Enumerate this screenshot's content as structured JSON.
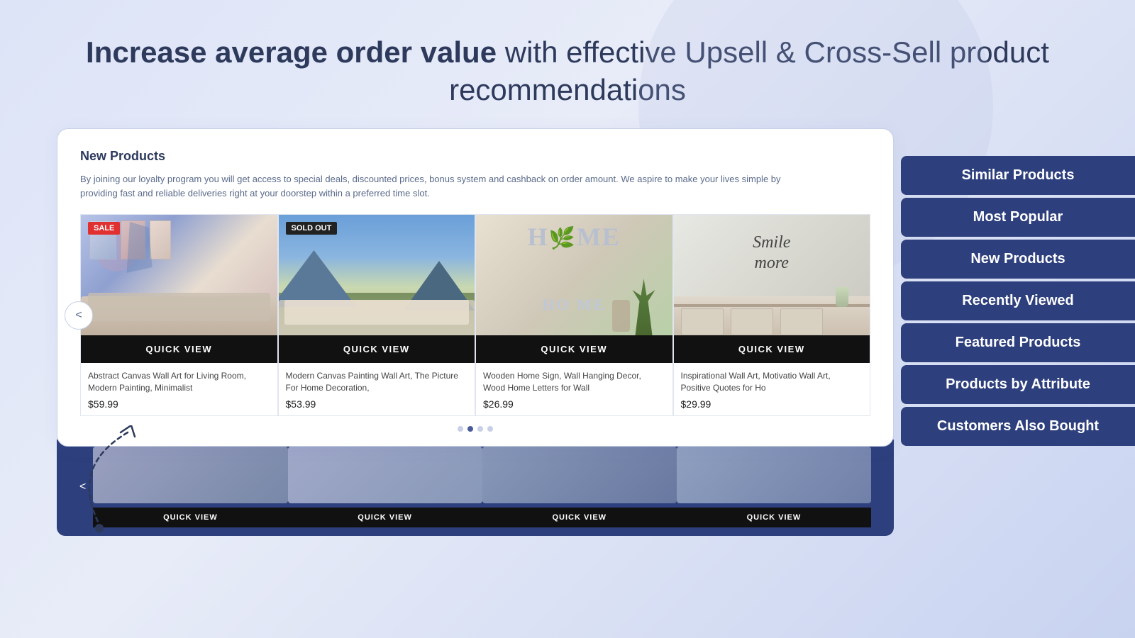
{
  "hero": {
    "bold_text": "Increase average order value",
    "regular_text": " with effective Upsell & Cross-Sell product recommendations"
  },
  "main_card": {
    "title": "New Products",
    "description": "By joining our loyalty program you will get access to special deals, discounted prices, bonus system and cashback on order amount. We aspire to make your lives simple by providing fast and reliable deliveries right at your doorstep within a preferred time slot."
  },
  "products": [
    {
      "badge": "SALE",
      "badge_type": "sale",
      "name": "Abstract Canvas Wall Art for Living Room, Modern Painting, Minimalist",
      "price": "$59.99",
      "quick_view": "QUICK VIEW"
    },
    {
      "badge": "SOLD OUT",
      "badge_type": "sold",
      "name": "Modern Canvas Painting Wall Art, The Picture For Home Decoration,",
      "price": "$53.99",
      "quick_view": "QUICK VIEW"
    },
    {
      "badge": "",
      "badge_type": "",
      "name": "Wooden Home Sign, Wall Hanging Decor, Wood Home Letters for Wall",
      "price": "$26.99",
      "quick_view": "QUICK VIEW"
    },
    {
      "badge": "",
      "badge_type": "",
      "name": "Inspirational Wall Art, Motivatio Wall Art, Positive Quotes for Ho",
      "price": "$29.99",
      "quick_view": "QUICK VIEW"
    }
  ],
  "dots": [
    {
      "active": false
    },
    {
      "active": true
    },
    {
      "active": false
    },
    {
      "active": false
    }
  ],
  "sidebar_labels": [
    {
      "id": "similar-products",
      "label": "Similar Products"
    },
    {
      "id": "most-popular",
      "label": "Most Popular"
    },
    {
      "id": "new-products",
      "label": "New Products"
    },
    {
      "id": "recently-viewed",
      "label": "Recently Viewed"
    },
    {
      "id": "featured-products",
      "label": "Featured Products"
    },
    {
      "id": "products-by-attribute",
      "label": "Products by Attribute"
    },
    {
      "id": "customers-also-bought",
      "label": "Customers Also Bought"
    }
  ],
  "bottom_section": {
    "nav_label": "<",
    "quick_view_label": "QUICK VIEW"
  },
  "nav_btn_label": "<"
}
